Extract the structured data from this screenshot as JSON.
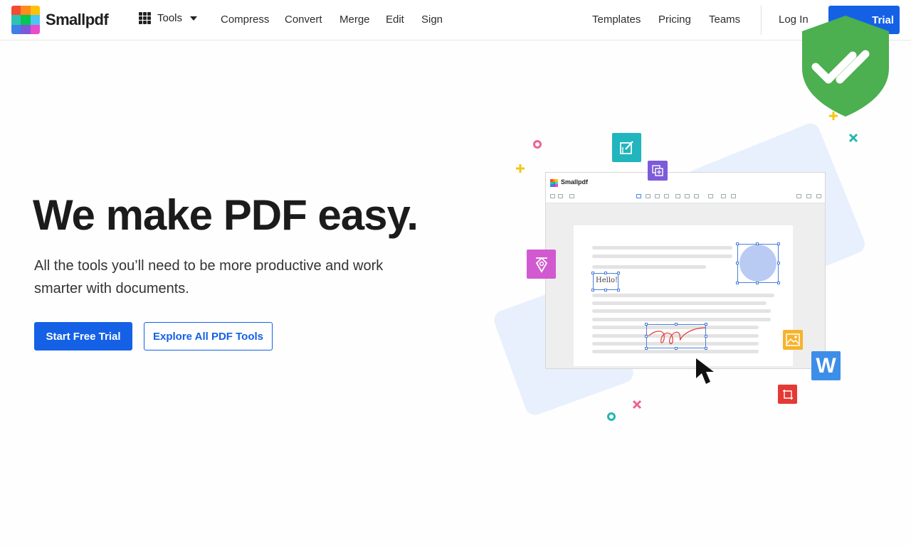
{
  "brand": {
    "name": "Smallpdf",
    "app_name": "Smallpdf"
  },
  "header": {
    "tools_label": "Tools",
    "nav_left": [
      "Compress",
      "Convert",
      "Merge",
      "Edit",
      "Sign"
    ],
    "nav_right": [
      "Templates",
      "Pricing",
      "Teams"
    ],
    "login_label": "Log In",
    "trial_label": "Trial"
  },
  "hero": {
    "title": "We make PDF easy.",
    "subtitle": "All the tools you’ll need to be more productive and work smarter with documents.",
    "primary_cta": "Start Free Trial",
    "secondary_cta": "Explore All PDF Tools"
  },
  "illustration": {
    "sample_text": "Hello!",
    "word_icon_letter": "W"
  },
  "colors": {
    "brand_blue": "#1461e6",
    "shield_green": "#4caf50",
    "logo_tiles": [
      "#f44a33",
      "#ff8a1f",
      "#ffc107",
      "#2ec2b4",
      "#00c853",
      "#4ac6f5",
      "#3f7fe8",
      "#7b59d9",
      "#e84ccc"
    ]
  },
  "icons": [
    "grid-icon",
    "caret-down-icon",
    "edit-icon",
    "copy-icon",
    "pen-icon",
    "image-icon",
    "word-icon",
    "crop-icon",
    "cursor-icon",
    "shield-check-icon"
  ]
}
